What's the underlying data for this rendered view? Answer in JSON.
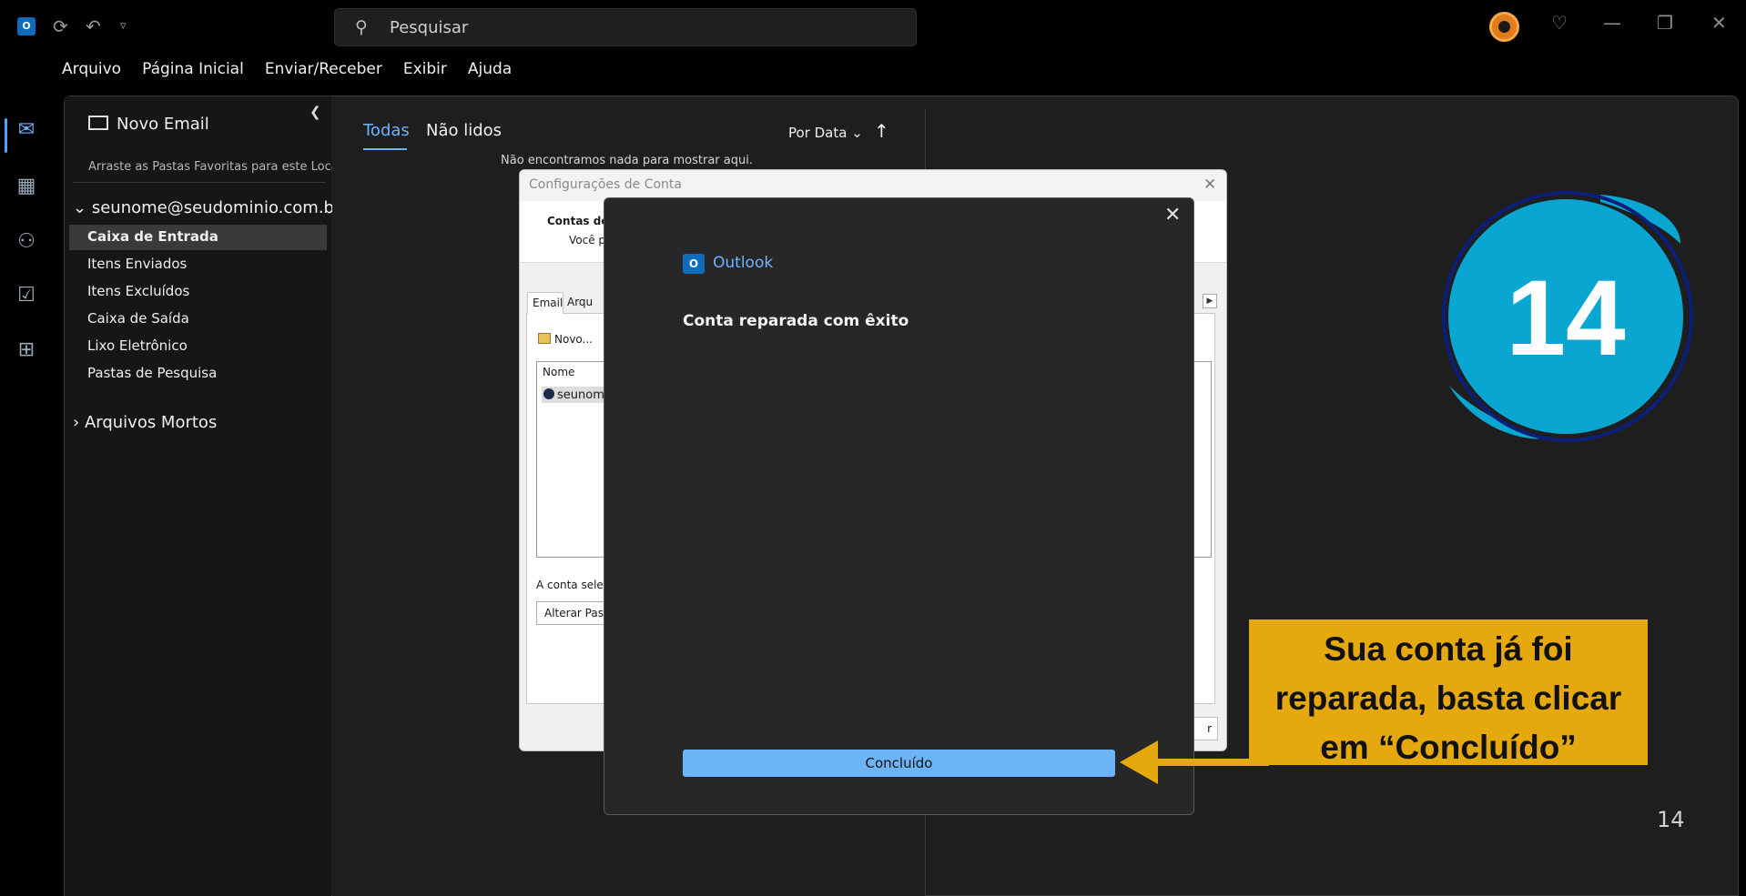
{
  "titlebar": {
    "search_placeholder": "Pesquisar",
    "app_logo": "O",
    "icons": [
      "outlook-logo-icon",
      "sync-icon",
      "undo-icon",
      "customize-icon",
      "avatar-icon",
      "lightbulb-icon",
      "minimize-icon",
      "restore-icon",
      "close-icon"
    ]
  },
  "menubar": {
    "items": [
      "Arquivo",
      "Página Inicial",
      "Enviar/Receber",
      "Exibir",
      "Ajuda"
    ]
  },
  "rail": {
    "items": [
      "mail-icon",
      "calendar-icon",
      "people-icon",
      "tasks-icon",
      "apps-icon"
    ]
  },
  "folder_pane": {
    "new_email": "Novo Email",
    "favorites_hint": "Arraste as Pastas Favoritas para este Local",
    "account": "seunome@seudominio.com.br",
    "folders": [
      "Caixa de Entrada",
      "Itens Enviados",
      "Itens Excluídos",
      "Caixa de Saída",
      "Lixo Eletrônico",
      "Pastas de Pesquisa"
    ],
    "selected_folder": "Caixa de Entrada",
    "archive": "Arquivos Mortos"
  },
  "list_pane": {
    "tabs": [
      "Todas",
      "Não lidos"
    ],
    "active_tab": "Todas",
    "sort": "Por Data",
    "empty_message": "Não encontramos nada para mostrar aqui."
  },
  "account_settings_dialog": {
    "title": "Configurações de Conta",
    "heading": "Contas de",
    "subtext": "Você p",
    "tabs": [
      "Email",
      "Arqu"
    ],
    "new_button": "Novo...",
    "column_name": "Nome",
    "row": "seunom",
    "selected_account_label": "A conta selec",
    "change_button": "Alterar Past",
    "close_button": "r"
  },
  "repair_dialog": {
    "brand": "Outlook",
    "brand_logo": "O",
    "message": "Conta reparada com êxito",
    "done_button": "Concluído"
  },
  "overlay": {
    "step_number": "14",
    "callout_lines": [
      "Sua conta já foi",
      "reparada, basta clicar",
      "em “Concluído”"
    ],
    "page_number": "14",
    "colors": {
      "badge": "#0aa6d2",
      "badge_ring": "#0b1f7a",
      "callout": "#e5a80e",
      "accent": "#6db4ff"
    }
  }
}
